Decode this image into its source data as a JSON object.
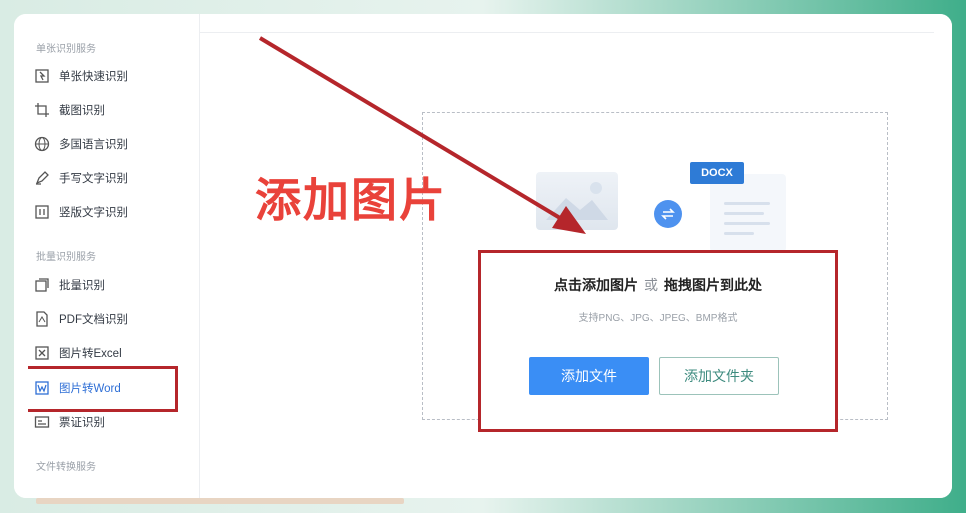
{
  "sidebar": {
    "section_single": "单张识别服务",
    "section_batch": "批量识别服务",
    "section_convert": "文件转换服务",
    "items": [
      {
        "label": "单张快速识别",
        "icon": "quick-scan-icon"
      },
      {
        "label": "截图识别",
        "icon": "crop-icon"
      },
      {
        "label": "多国语言识别",
        "icon": "globe-icon"
      },
      {
        "label": "手写文字识别",
        "icon": "pen-icon"
      },
      {
        "label": "竖版文字识别",
        "icon": "vertical-text-icon"
      },
      {
        "label": "批量识别",
        "icon": "batch-icon"
      },
      {
        "label": "PDF文档识别",
        "icon": "pdf-icon"
      },
      {
        "label": "图片转Excel",
        "icon": "excel-icon"
      },
      {
        "label": "图片转Word",
        "icon": "word-icon"
      },
      {
        "label": "票证识别",
        "icon": "ticket-icon"
      }
    ]
  },
  "overlay": {
    "title": "添加图片"
  },
  "dropzone": {
    "main_tip_a": "点击添加图片",
    "main_tip_or": "或",
    "main_tip_b": "拖拽图片到此处",
    "sub_tip": "支持PNG、JPG、JPEG、BMP格式",
    "docx_label": "DOCX",
    "add_file": "添加文件",
    "add_folder": "添加文件夹"
  },
  "colors": {
    "accent": "#3a8ef5",
    "annotation_red": "#b5262b",
    "title_red": "#e9423a"
  }
}
